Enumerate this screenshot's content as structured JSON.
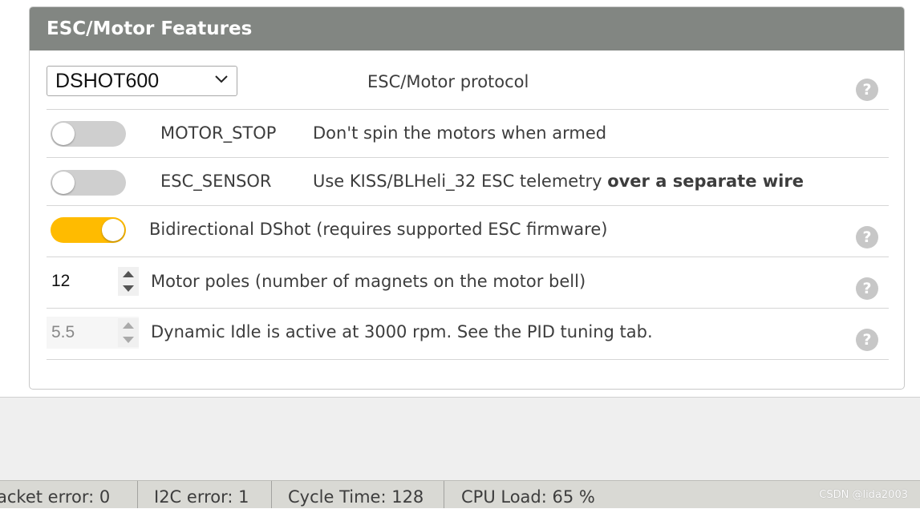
{
  "panel": {
    "title": "ESC/Motor Features",
    "protocol": {
      "selected": "DSHOT600",
      "label": "ESC/Motor protocol",
      "help": "?"
    },
    "motor_stop": {
      "enabled": false,
      "name": "MOTOR_STOP",
      "description": "Don't spin the motors when armed"
    },
    "esc_sensor": {
      "enabled": false,
      "name": "ESC_SENSOR",
      "description": "Use KISS/BLHeli_32 ESC telemetry ",
      "description_bold": "over a separate wire"
    },
    "bidir_dshot": {
      "enabled": true,
      "label": "Bidirectional DShot (requires supported ESC firmware)",
      "help": "?"
    },
    "motor_poles": {
      "value": "12",
      "label": "Motor poles (number of magnets on the motor bell)",
      "help": "?"
    },
    "dynamic_idle": {
      "value": "5.5",
      "label": "Dynamic Idle is active at 3000 rpm. See the PID tuning tab.",
      "help": "?"
    }
  },
  "status_bar": {
    "packet_error": "acket error: 0",
    "i2c_error": "I2C error: 1",
    "cycle_time": "Cycle Time: 128",
    "cpu_load": "CPU Load: 65 %",
    "watermark": "CSDN @lida2003"
  },
  "colors": {
    "header_bg": "#828682",
    "toggle_on": "#ffbb00",
    "toggle_off": "#cfcfcf"
  }
}
